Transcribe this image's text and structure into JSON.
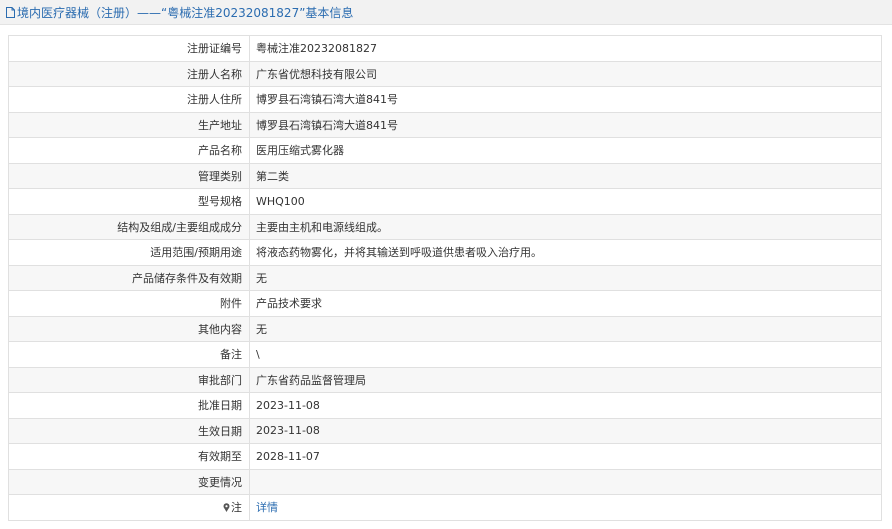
{
  "header": {
    "title": "境内医疗器械（注册）——“粤械注准20232081827”基本信息",
    "icon": "document-icon"
  },
  "rows": [
    {
      "label": "注册证编号",
      "value": "粤械注准20232081827"
    },
    {
      "label": "注册人名称",
      "value": "广东省优想科技有限公司"
    },
    {
      "label": "注册人住所",
      "value": "博罗县石湾镇石湾大道841号"
    },
    {
      "label": "生产地址",
      "value": "博罗县石湾镇石湾大道841号"
    },
    {
      "label": "产品名称",
      "value": "医用压缩式雾化器"
    },
    {
      "label": "管理类别",
      "value": "第二类"
    },
    {
      "label": "型号规格",
      "value": "WHQ100"
    },
    {
      "label": "结构及组成/主要组成成分",
      "value": "主要由主机和电源线组成。"
    },
    {
      "label": "适用范围/预期用途",
      "value": "将液态药物雾化，并将其输送到呼吸道供患者吸入治疗用。"
    },
    {
      "label": "产品储存条件及有效期",
      "value": "无"
    },
    {
      "label": "附件",
      "value": "产品技术要求"
    },
    {
      "label": "其他内容",
      "value": "无"
    },
    {
      "label": "备注",
      "value": "\\"
    },
    {
      "label": "审批部门",
      "value": "广东省药品监督管理局"
    },
    {
      "label": "批准日期",
      "value": "2023-11-08"
    },
    {
      "label": "生效日期",
      "value": "2023-11-08"
    },
    {
      "label": "有效期至",
      "value": "2028-11-07"
    },
    {
      "label": "变更情况",
      "value": ""
    }
  ],
  "note_row": {
    "label": "注",
    "icon": "pin-icon",
    "link_text": "详情"
  },
  "colors": {
    "link": "#2b6cb0",
    "header_bg": "#f2f2f2",
    "stripe": "#f7f7f7",
    "border": "#e0e0e0"
  }
}
